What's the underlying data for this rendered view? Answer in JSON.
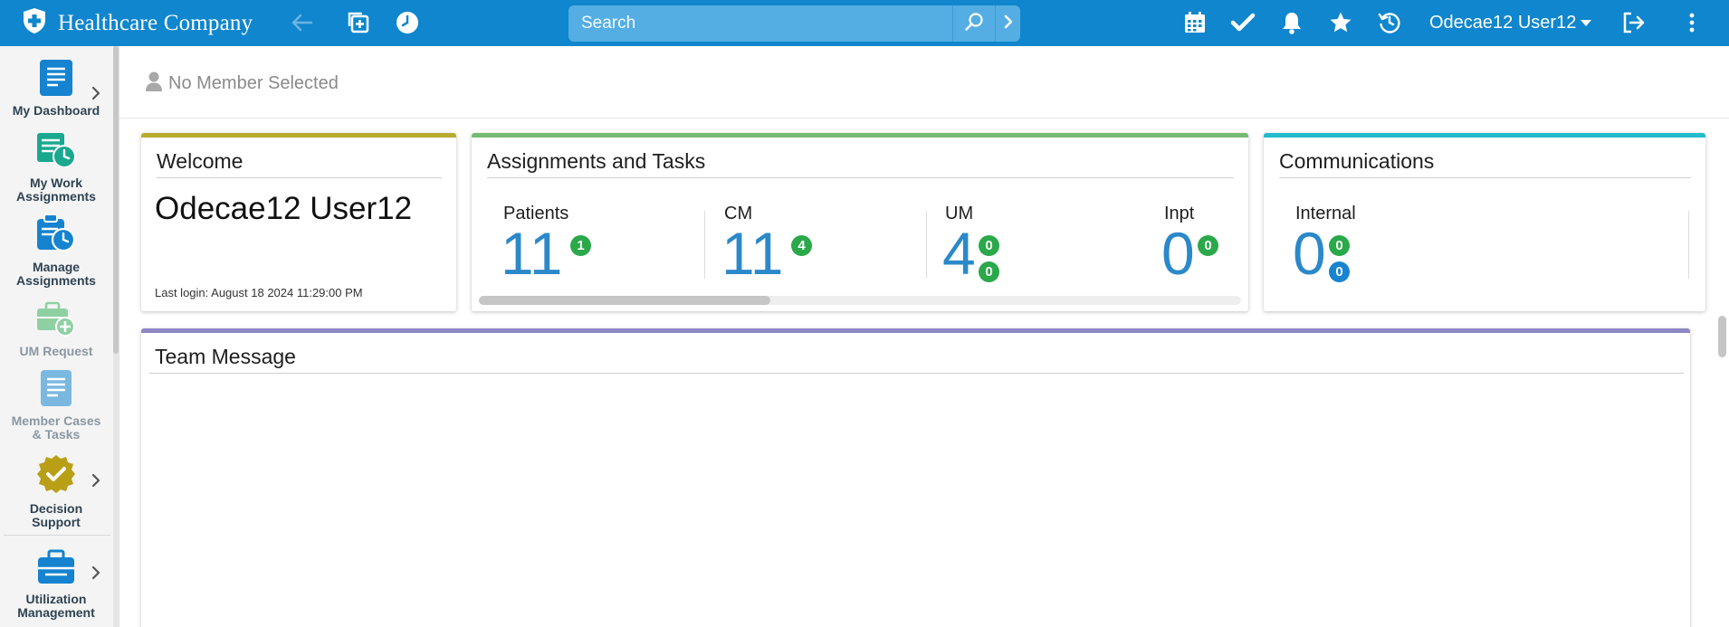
{
  "app": {
    "brand": "Healthcare Company"
  },
  "topbar": {
    "search_placeholder": "Search",
    "user_name": "Odecae12 User12",
    "icons": [
      "shield-plus-icon",
      "back-arrow-icon",
      "add-window-icon",
      "clock-icon",
      "search-icon",
      "chevron-right-icon",
      "calendar-icon",
      "checkmark-icon",
      "bell-icon",
      "star-icon",
      "history-icon",
      "logout-icon",
      "more-vertical-icon"
    ]
  },
  "sidebar": {
    "items": [
      {
        "label": "My Dashboard",
        "icon": "dashboard-document-icon",
        "has_chevron": true,
        "enabled": true
      },
      {
        "label": "My Work Assignments",
        "icon": "clipboard-clock-icon",
        "has_chevron": false,
        "enabled": true
      },
      {
        "label": "Manage Assignments",
        "icon": "assignment-clock-icon",
        "has_chevron": false,
        "enabled": true
      },
      {
        "label": "UM Request",
        "icon": "briefcase-plus-icon",
        "has_chevron": false,
        "enabled": false
      },
      {
        "label": "Member Cases & Tasks",
        "icon": "document-lines-icon",
        "has_chevron": false,
        "enabled": false
      },
      {
        "label": "Decision Support",
        "icon": "badge-check-icon",
        "has_chevron": true,
        "enabled": true
      },
      {
        "label": "Utilization Management",
        "icon": "briefcase-icon",
        "has_chevron": true,
        "enabled": true
      }
    ]
  },
  "member": {
    "status": "No Member Selected"
  },
  "welcome": {
    "title": "Welcome",
    "user_name": "Odecae12 User12",
    "last_login": "Last login: August 18 2024 11:29:00 PM"
  },
  "assignments": {
    "title": "Assignments and Tasks",
    "stats": [
      {
        "label": "Patients",
        "value": "11",
        "badges": [
          "1"
        ]
      },
      {
        "label": "CM",
        "value": "11",
        "badges": [
          "4"
        ]
      },
      {
        "label": "UM",
        "value": "4",
        "badges": [
          "0",
          "0"
        ]
      },
      {
        "label": "Inpt",
        "value": "0",
        "badges": [
          "0"
        ]
      }
    ]
  },
  "communications": {
    "title": "Communications",
    "stats": [
      {
        "label": "Internal",
        "value": "0",
        "badges": [
          "0",
          "0"
        ]
      }
    ]
  },
  "team_message": {
    "title": "Team Message"
  },
  "colors": {
    "topbar": "#0f86cd",
    "welcome_accent": "#b8ac2f",
    "assignments_accent": "#74bb74",
    "communications_accent": "#22bccc",
    "team_message_accent": "#8d87c4",
    "stat_number": "#2b89c9",
    "badge_green": "#2aa84a",
    "badge_blue": "#1784cf"
  }
}
